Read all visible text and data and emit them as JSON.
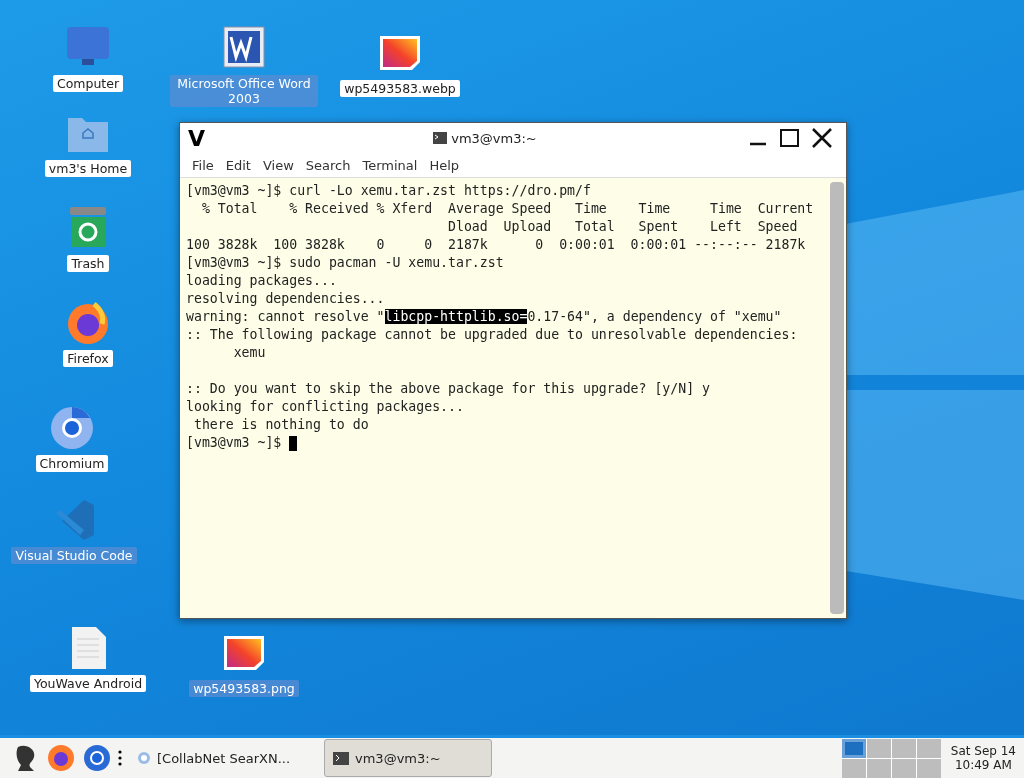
{
  "desktop_icons": [
    {
      "label": "Computer",
      "kind": "monitor",
      "selected": false
    },
    {
      "label": "Microsoft Office Word 2003",
      "kind": "word",
      "selected": true
    },
    {
      "label": "wp5493583.webp",
      "kind": "image",
      "selected": false
    },
    {
      "label": "vm3's Home",
      "kind": "folder",
      "selected": false
    },
    {
      "label": "Trash",
      "kind": "trash",
      "selected": false
    },
    {
      "label": "Firefox",
      "kind": "firefox",
      "selected": false
    },
    {
      "label": "Chromium",
      "kind": "chromium",
      "selected": false
    },
    {
      "label": "Visual Studio Code",
      "kind": "vscode",
      "selected": true
    },
    {
      "label": "YouWave Android",
      "kind": "document",
      "selected": false
    },
    {
      "label": "wp5493583.png",
      "kind": "image",
      "selected": true
    }
  ],
  "window": {
    "title": "vm3@vm3:~",
    "logo": "V",
    "menu": [
      "File",
      "Edit",
      "View",
      "Search",
      "Terminal",
      "Help"
    ],
    "lines": [
      [
        {
          "text": "[vm3@vm3 ~]$ curl -Lo xemu.tar.zst https://dro.pm/f",
          "selected": false
        }
      ],
      [
        {
          "text": "  % Total    % Received % Xferd  Average Speed   Time    Time     Time  Current",
          "selected": false
        }
      ],
      [
        {
          "text": "                                 Dload  Upload   Total   Spent    Left  Speed",
          "selected": false
        }
      ],
      [
        {
          "text": "100 3828k  100 3828k    0     0  2187k      0  0:00:01  0:00:01 --:--:-- 2187k",
          "selected": false
        }
      ],
      [
        {
          "text": "[vm3@vm3 ~]$ sudo pacman -U xemu.tar.zst",
          "selected": false
        }
      ],
      [
        {
          "text": "loading packages...",
          "selected": false
        }
      ],
      [
        {
          "text": "resolving dependencies...",
          "selected": false
        }
      ],
      [
        {
          "text": "warning: cannot resolve \"",
          "selected": false
        },
        {
          "text": "libcpp-httplib.so=",
          "selected": true
        },
        {
          "text": "0.17-64\", a dependency of \"xemu\"",
          "selected": false
        }
      ],
      [
        {
          "text": ":: The following package cannot be upgraded due to unresolvable dependencies:",
          "selected": false
        }
      ],
      [
        {
          "text": "      xemu",
          "selected": false
        }
      ],
      [
        {
          "text": ":: Do you want to skip the above package for this upgrade? [y/N] y",
          "selected": false
        }
      ],
      [
        {
          "text": "looking for conflicting packages...",
          "selected": false
        }
      ],
      [
        {
          "text": " there is nothing to do",
          "selected": false
        }
      ],
      [
        {
          "text": "[vm3@vm3 ~]$ ",
          "selected": false
        }
      ]
    ]
  },
  "taskbar": {
    "tasks": [
      {
        "label": "[CollabNet SearXN...",
        "kind": "browser",
        "selected": false
      },
      {
        "label": "vm3@vm3:~",
        "kind": "terminal",
        "selected": true
      }
    ],
    "workspaces": [
      {
        "selected": true
      },
      {
        "selected": false
      },
      {
        "selected": false
      },
      {
        "selected": false
      },
      {
        "selected": false
      },
      {
        "selected": false
      },
      {
        "selected": false
      },
      {
        "selected": false
      }
    ],
    "clock": {
      "date": "Sat Sep 14",
      "time": "10:49 AM"
    }
  }
}
